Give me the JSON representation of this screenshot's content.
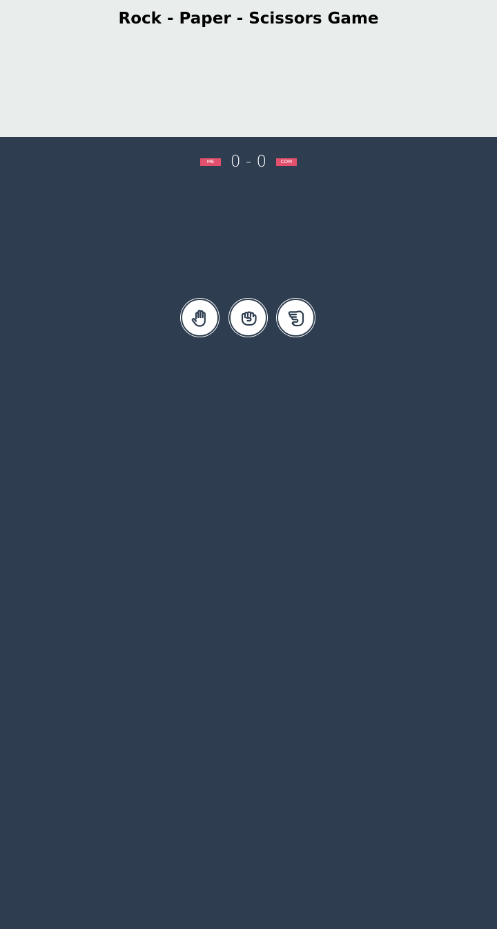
{
  "header": {
    "title": "Rock - Paper - Scissors Game"
  },
  "scoreboard": {
    "user_label": "ME",
    "computer_label": "COM",
    "score_text": "0 - 0"
  },
  "choices": [
    {
      "id": "paper",
      "icon": "hand-open-icon"
    },
    {
      "id": "rock",
      "icon": "hand-fist-icon"
    },
    {
      "id": "scissors",
      "icon": "hand-scissors-icon"
    }
  ],
  "colors": {
    "header_background": "#e9eeed",
    "game_background": "#2e3d50",
    "badge": "#e2506d",
    "choice_button": "#ffffff",
    "icon_stroke": "#2e3d50"
  }
}
